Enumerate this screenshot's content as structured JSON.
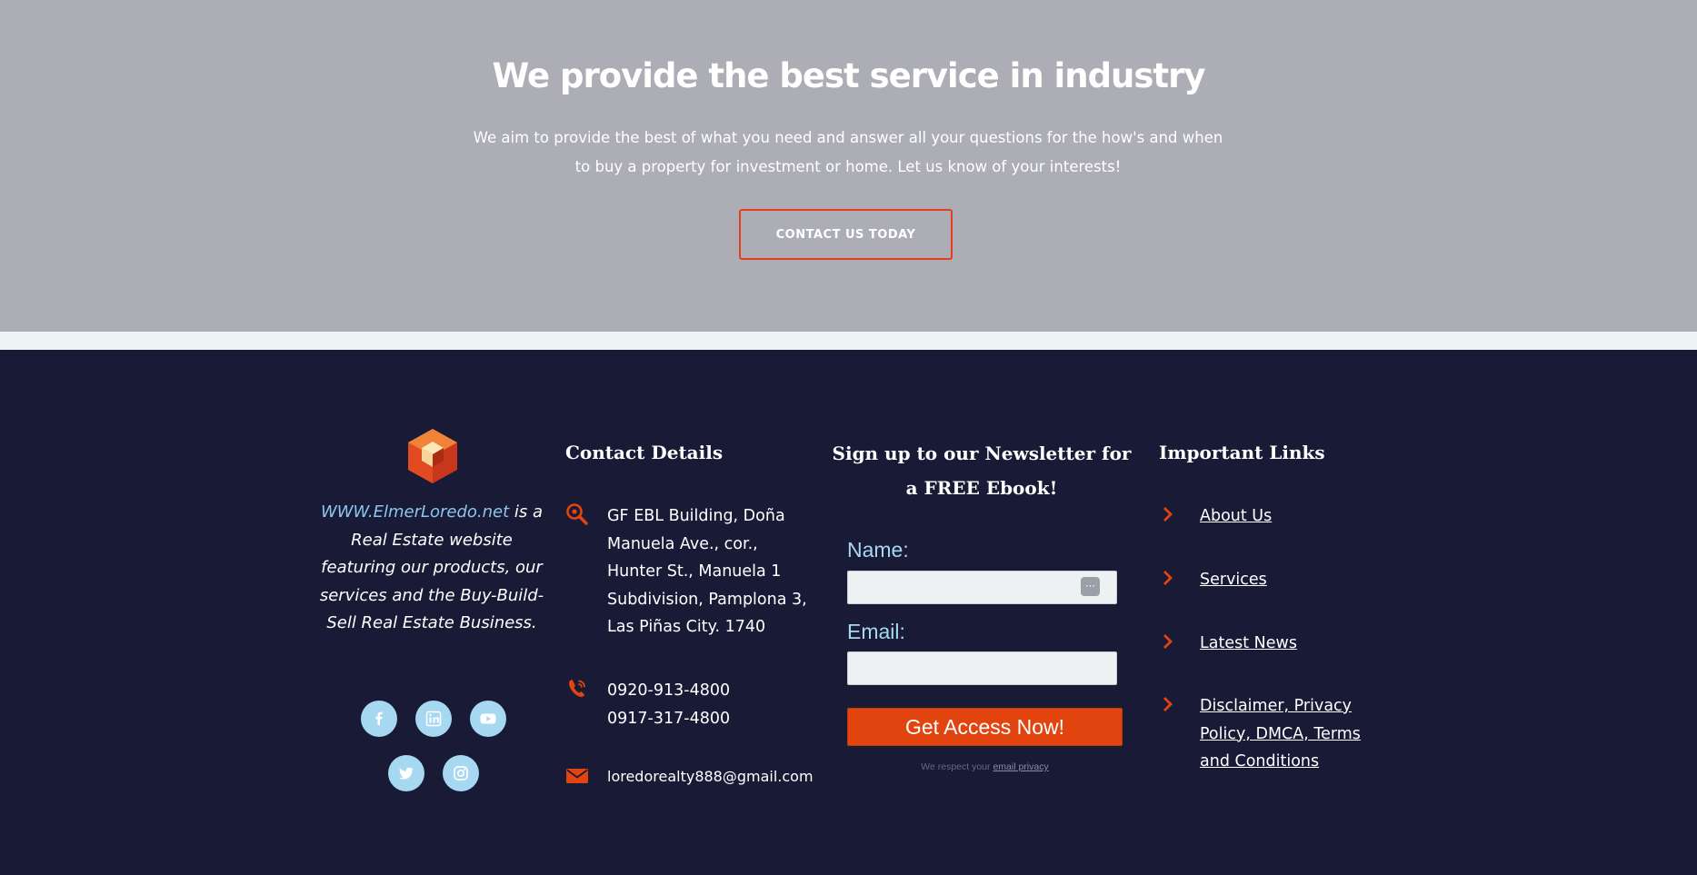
{
  "cta": {
    "title": "We provide the best service in industry",
    "description": "We aim to provide the best of what you need and answer all your questions for the how's and when to buy a property for investment or home.  Let us know of your interests!",
    "button_label": "CONTACT US TODAY"
  },
  "footer": {
    "about": {
      "site_link": "WWW.ElmerLoredo.net",
      "text": " is a Real Estate website featuring our products, our services and the Buy-Build-Sell Real Estate Business."
    },
    "social": [
      "facebook-icon",
      "linkedin-icon",
      "youtube-icon",
      "twitter-icon",
      "instagram-icon"
    ],
    "contact": {
      "title": "Contact Details",
      "address": "GF EBL Building, Doña Manuela Ave., cor., Hunter St., Manuela 1 Subdivision, Pamplona 3, Las Piñas City. 1740",
      "phone1": "0920-913-4800",
      "phone2": "0917-317-4800",
      "email": "loredorealty888@gmail.com"
    },
    "newsletter": {
      "title": "Sign up to our Newsletter for a FREE Ebook!",
      "name_label": "Name:",
      "email_label": "Email:",
      "button_label": "Get Access Now!",
      "privacy_prefix": "We respect your ",
      "privacy_link": "email privacy"
    },
    "links": {
      "title": "Important Links",
      "items": [
        "About Us",
        "Services ",
        "Latest News",
        "Disclaimer, Privacy Policy, DMCA, Terms and Conditions"
      ]
    }
  },
  "colors": {
    "cta_bg": "#acadb5",
    "footer_bg": "#191a36",
    "accent": "#e1440e",
    "light_blue": "#a7d8f1"
  }
}
